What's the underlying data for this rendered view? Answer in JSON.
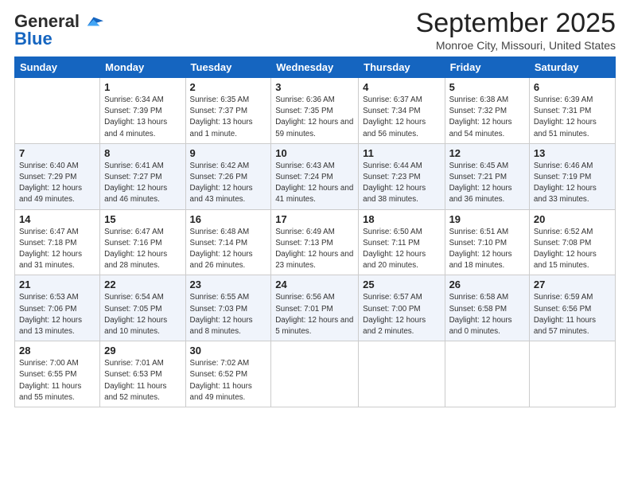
{
  "logo": {
    "general": "General",
    "blue": "Blue"
  },
  "header": {
    "month": "September 2025",
    "location": "Monroe City, Missouri, United States"
  },
  "days": [
    "Sunday",
    "Monday",
    "Tuesday",
    "Wednesday",
    "Thursday",
    "Friday",
    "Saturday"
  ],
  "weeks": [
    [
      {
        "num": "",
        "sunrise": "",
        "sunset": "",
        "daylight": "",
        "empty": true
      },
      {
        "num": "1",
        "sunrise": "Sunrise: 6:34 AM",
        "sunset": "Sunset: 7:39 PM",
        "daylight": "Daylight: 13 hours and 4 minutes."
      },
      {
        "num": "2",
        "sunrise": "Sunrise: 6:35 AM",
        "sunset": "Sunset: 7:37 PM",
        "daylight": "Daylight: 13 hours and 1 minute."
      },
      {
        "num": "3",
        "sunrise": "Sunrise: 6:36 AM",
        "sunset": "Sunset: 7:35 PM",
        "daylight": "Daylight: 12 hours and 59 minutes."
      },
      {
        "num": "4",
        "sunrise": "Sunrise: 6:37 AM",
        "sunset": "Sunset: 7:34 PM",
        "daylight": "Daylight: 12 hours and 56 minutes."
      },
      {
        "num": "5",
        "sunrise": "Sunrise: 6:38 AM",
        "sunset": "Sunset: 7:32 PM",
        "daylight": "Daylight: 12 hours and 54 minutes."
      },
      {
        "num": "6",
        "sunrise": "Sunrise: 6:39 AM",
        "sunset": "Sunset: 7:31 PM",
        "daylight": "Daylight: 12 hours and 51 minutes."
      }
    ],
    [
      {
        "num": "7",
        "sunrise": "Sunrise: 6:40 AM",
        "sunset": "Sunset: 7:29 PM",
        "daylight": "Daylight: 12 hours and 49 minutes."
      },
      {
        "num": "8",
        "sunrise": "Sunrise: 6:41 AM",
        "sunset": "Sunset: 7:27 PM",
        "daylight": "Daylight: 12 hours and 46 minutes."
      },
      {
        "num": "9",
        "sunrise": "Sunrise: 6:42 AM",
        "sunset": "Sunset: 7:26 PM",
        "daylight": "Daylight: 12 hours and 43 minutes."
      },
      {
        "num": "10",
        "sunrise": "Sunrise: 6:43 AM",
        "sunset": "Sunset: 7:24 PM",
        "daylight": "Daylight: 12 hours and 41 minutes."
      },
      {
        "num": "11",
        "sunrise": "Sunrise: 6:44 AM",
        "sunset": "Sunset: 7:23 PM",
        "daylight": "Daylight: 12 hours and 38 minutes."
      },
      {
        "num": "12",
        "sunrise": "Sunrise: 6:45 AM",
        "sunset": "Sunset: 7:21 PM",
        "daylight": "Daylight: 12 hours and 36 minutes."
      },
      {
        "num": "13",
        "sunrise": "Sunrise: 6:46 AM",
        "sunset": "Sunset: 7:19 PM",
        "daylight": "Daylight: 12 hours and 33 minutes."
      }
    ],
    [
      {
        "num": "14",
        "sunrise": "Sunrise: 6:47 AM",
        "sunset": "Sunset: 7:18 PM",
        "daylight": "Daylight: 12 hours and 31 minutes."
      },
      {
        "num": "15",
        "sunrise": "Sunrise: 6:47 AM",
        "sunset": "Sunset: 7:16 PM",
        "daylight": "Daylight: 12 hours and 28 minutes."
      },
      {
        "num": "16",
        "sunrise": "Sunrise: 6:48 AM",
        "sunset": "Sunset: 7:14 PM",
        "daylight": "Daylight: 12 hours and 26 minutes."
      },
      {
        "num": "17",
        "sunrise": "Sunrise: 6:49 AM",
        "sunset": "Sunset: 7:13 PM",
        "daylight": "Daylight: 12 hours and 23 minutes."
      },
      {
        "num": "18",
        "sunrise": "Sunrise: 6:50 AM",
        "sunset": "Sunset: 7:11 PM",
        "daylight": "Daylight: 12 hours and 20 minutes."
      },
      {
        "num": "19",
        "sunrise": "Sunrise: 6:51 AM",
        "sunset": "Sunset: 7:10 PM",
        "daylight": "Daylight: 12 hours and 18 minutes."
      },
      {
        "num": "20",
        "sunrise": "Sunrise: 6:52 AM",
        "sunset": "Sunset: 7:08 PM",
        "daylight": "Daylight: 12 hours and 15 minutes."
      }
    ],
    [
      {
        "num": "21",
        "sunrise": "Sunrise: 6:53 AM",
        "sunset": "Sunset: 7:06 PM",
        "daylight": "Daylight: 12 hours and 13 minutes."
      },
      {
        "num": "22",
        "sunrise": "Sunrise: 6:54 AM",
        "sunset": "Sunset: 7:05 PM",
        "daylight": "Daylight: 12 hours and 10 minutes."
      },
      {
        "num": "23",
        "sunrise": "Sunrise: 6:55 AM",
        "sunset": "Sunset: 7:03 PM",
        "daylight": "Daylight: 12 hours and 8 minutes."
      },
      {
        "num": "24",
        "sunrise": "Sunrise: 6:56 AM",
        "sunset": "Sunset: 7:01 PM",
        "daylight": "Daylight: 12 hours and 5 minutes."
      },
      {
        "num": "25",
        "sunrise": "Sunrise: 6:57 AM",
        "sunset": "Sunset: 7:00 PM",
        "daylight": "Daylight: 12 hours and 2 minutes."
      },
      {
        "num": "26",
        "sunrise": "Sunrise: 6:58 AM",
        "sunset": "Sunset: 6:58 PM",
        "daylight": "Daylight: 12 hours and 0 minutes."
      },
      {
        "num": "27",
        "sunrise": "Sunrise: 6:59 AM",
        "sunset": "Sunset: 6:56 PM",
        "daylight": "Daylight: 11 hours and 57 minutes."
      }
    ],
    [
      {
        "num": "28",
        "sunrise": "Sunrise: 7:00 AM",
        "sunset": "Sunset: 6:55 PM",
        "daylight": "Daylight: 11 hours and 55 minutes."
      },
      {
        "num": "29",
        "sunrise": "Sunrise: 7:01 AM",
        "sunset": "Sunset: 6:53 PM",
        "daylight": "Daylight: 11 hours and 52 minutes."
      },
      {
        "num": "30",
        "sunrise": "Sunrise: 7:02 AM",
        "sunset": "Sunset: 6:52 PM",
        "daylight": "Daylight: 11 hours and 49 minutes."
      },
      {
        "num": "",
        "sunrise": "",
        "sunset": "",
        "daylight": "",
        "empty": true
      },
      {
        "num": "",
        "sunrise": "",
        "sunset": "",
        "daylight": "",
        "empty": true
      },
      {
        "num": "",
        "sunrise": "",
        "sunset": "",
        "daylight": "",
        "empty": true
      },
      {
        "num": "",
        "sunrise": "",
        "sunset": "",
        "daylight": "",
        "empty": true
      }
    ]
  ]
}
